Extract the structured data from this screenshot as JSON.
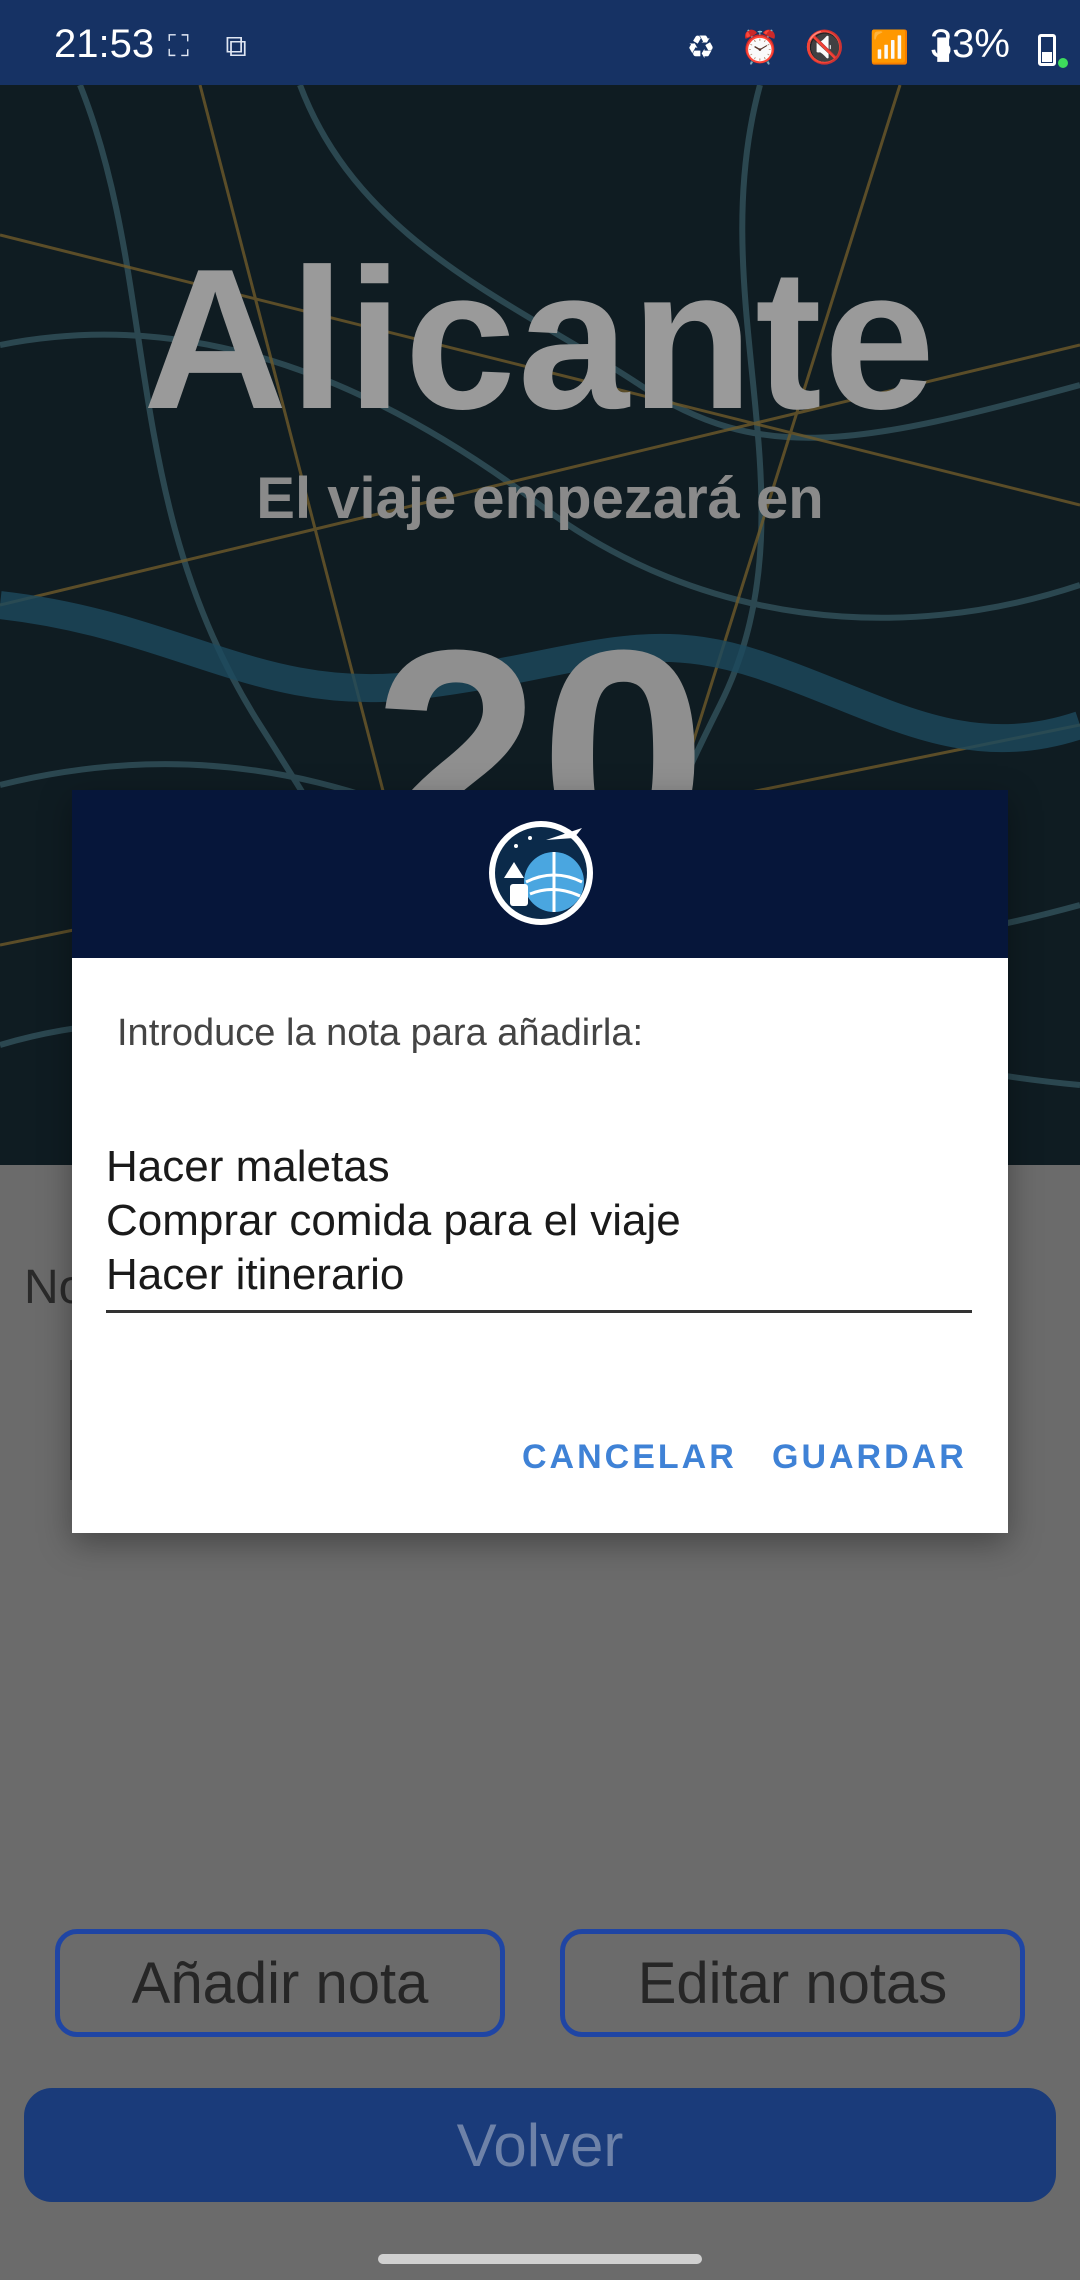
{
  "status_bar": {
    "time": "21:53",
    "left_icons": "⛶ ⧉",
    "right_icons": "♻ ⏰ 🔇 📶 ▮",
    "battery": "33%"
  },
  "hero": {
    "city": "Alicante",
    "subtitle": "El viaje empezará en",
    "days": "20"
  },
  "notes": {
    "title_partial": "No"
  },
  "buttons": {
    "add_note": "Añadir nota",
    "edit_notes": "Editar notas",
    "back": "Volver"
  },
  "dialog": {
    "prompt": "Introduce la nota para añadirla:",
    "input_lines": [
      "Hacer maletas",
      "Comprar comida para el viaje",
      "Hacer itinerario"
    ],
    "cancel": "CANCELAR",
    "save": "GUARDAR"
  },
  "colors": {
    "status_bar": "#163264",
    "dialog_header": "#06163a",
    "accent_button": "#3f82d6",
    "outline_button": "#1f45a4"
  }
}
